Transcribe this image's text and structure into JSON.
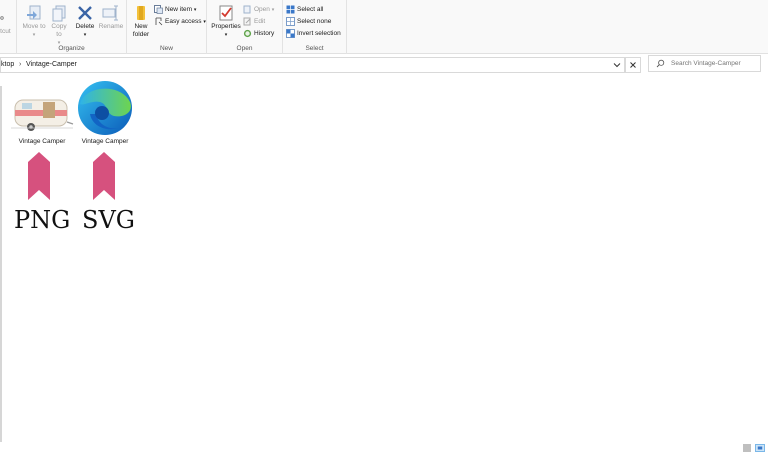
{
  "ribbon": {
    "clipboard": {
      "partial_label": "rtcut"
    },
    "organize": {
      "label": "Organize",
      "move_to": "Move to",
      "copy_to": "Copy to",
      "delete": "Delete",
      "rename": "Rename"
    },
    "new": {
      "label": "New",
      "new_folder": "New folder",
      "new_item": "New item",
      "easy_access": "Easy access"
    },
    "open": {
      "label": "Open",
      "properties": "Properties",
      "open": "Open",
      "edit": "Edit",
      "history": "History"
    },
    "select": {
      "label": "Select",
      "select_all": "Select all",
      "select_none": "Select none",
      "invert_selection": "Invert selection"
    }
  },
  "address": {
    "crumbs": [
      "ktop",
      "Vintage-Camper"
    ]
  },
  "search": {
    "placeholder": "Search Vintage-Camper"
  },
  "files": [
    {
      "name": "Vintage Camper",
      "icon": "camper-thumbnail-icon"
    },
    {
      "name": "Vintage Camper",
      "icon": "edge-browser-icon"
    }
  ],
  "overlay": {
    "png_label": "PNG",
    "svg_label": "SVG"
  },
  "colors": {
    "ribbon_bg": "#f9f9f9",
    "bookmark": "#d6517e",
    "accent": "#0078d4"
  }
}
